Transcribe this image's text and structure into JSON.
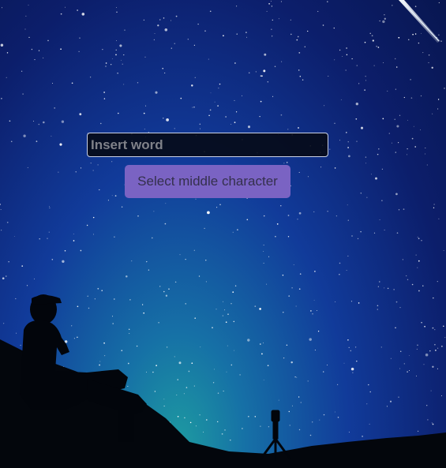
{
  "input": {
    "placeholder": "Insert word",
    "value": ""
  },
  "button": {
    "label": "Select middle character"
  },
  "colors": {
    "button_bg": "#7a63c3",
    "button_text": "#34304c",
    "input_bg": "#060a16",
    "input_border": "#c9d1e6",
    "sky_top": "#081650",
    "sky_horizon": "#1d9aa1"
  },
  "icons": {
    "background": "starry-night-sky-image",
    "meteor": "shooting-star-icon",
    "person": "seated-person-silhouette",
    "camera": "camera-tripod-silhouette"
  }
}
